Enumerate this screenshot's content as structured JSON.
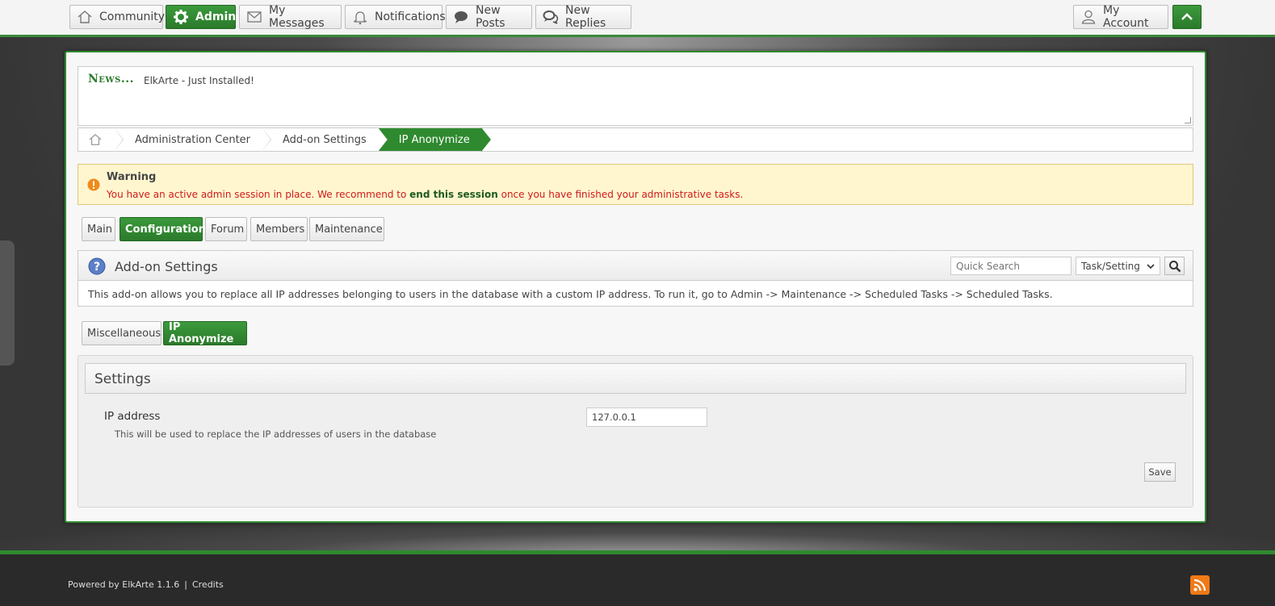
{
  "topbar": {
    "items": [
      {
        "label": "Community",
        "icon": "home-icon"
      },
      {
        "label": "Admin",
        "icon": "gear-icon",
        "active": true
      },
      {
        "label": "My Messages",
        "icon": "envelope-icon"
      },
      {
        "label": "Notifications",
        "icon": "bell-icon"
      },
      {
        "label": "New Posts",
        "icon": "chat-bubble-icon"
      },
      {
        "label": "New Replies",
        "icon": "chat-bubbles-icon"
      }
    ],
    "account_label": "My Account",
    "account_icon": "user-icon",
    "collapse_icon": "chevron-up-icon"
  },
  "news": {
    "title": "News...",
    "text": "ElkArte - Just Installed!"
  },
  "breadcrumb": {
    "home_icon": "home-icon",
    "items": [
      "Administration Center",
      "Add-on Settings",
      "IP Anonymize"
    ]
  },
  "warning": {
    "title": "Warning",
    "text_before": "You have an active admin session in place. We recommend to ",
    "link": "end this session",
    "text_after": " once you have finished your administrative tasks."
  },
  "admin_tabs": [
    {
      "label": "Main"
    },
    {
      "label": "Configuration",
      "active": true
    },
    {
      "label": "Forum"
    },
    {
      "label": "Members"
    },
    {
      "label": "Maintenance"
    }
  ],
  "addon": {
    "title": "Add-on Settings",
    "help_icon": "help-icon",
    "quick_search_placeholder": "Quick Search",
    "search_type": "Task/Setting",
    "search_icon": "search-icon",
    "description": "This add-on allows you to replace all IP addresses belonging to users in the database with a custom IP address. To run it, go to Admin -> Maintenance -> Scheduled Tasks -> Scheduled Tasks."
  },
  "sub_tabs": [
    {
      "label": "Miscellaneous"
    },
    {
      "label": "IP Anonymize",
      "active": true
    }
  ],
  "settings": {
    "title": "Settings",
    "field_label": "IP address",
    "field_desc": "This will be used to replace the IP addresses of users in the database",
    "field_value": "127.0.0.1",
    "save_label": "Save"
  },
  "footer": {
    "powered": "Powered by ElkArte 1.1.6",
    "credits": "Credits",
    "rss_icon": "rss-icon"
  },
  "colors": {
    "accent": "#2f8a2f",
    "warning_bg": "#fff6cf",
    "warning_text": "#d01a1a",
    "footer_bg": "#2a2a2a"
  }
}
